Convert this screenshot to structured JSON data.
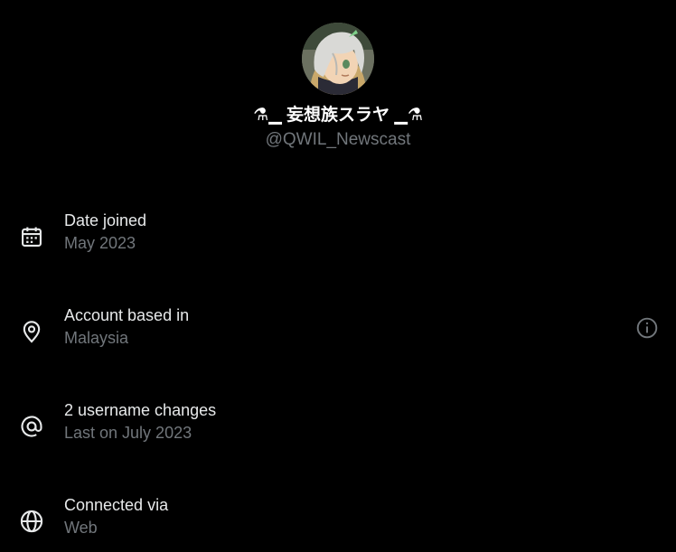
{
  "profile": {
    "display_name": "⚗︎▁ 妄想族スラヤ ▁⚗︎",
    "handle": "@QWIL_Newscast",
    "avatar_icon": "anime-avatar"
  },
  "rows": [
    {
      "icon": "calendar-icon",
      "title": "Date joined",
      "subtitle": "May 2023"
    },
    {
      "icon": "location-pin-icon",
      "title": "Account based in",
      "subtitle": "Malaysia",
      "trailing_icon": "info-icon"
    },
    {
      "icon": "at-sign-icon",
      "title": "2 username changes",
      "subtitle": "Last on July 2023"
    },
    {
      "icon": "globe-icon",
      "title": "Connected via",
      "subtitle": "Web"
    }
  ],
  "colors": {
    "background": "#000000",
    "primary_text": "#e7e9ea",
    "secondary_text": "#71767b"
  }
}
